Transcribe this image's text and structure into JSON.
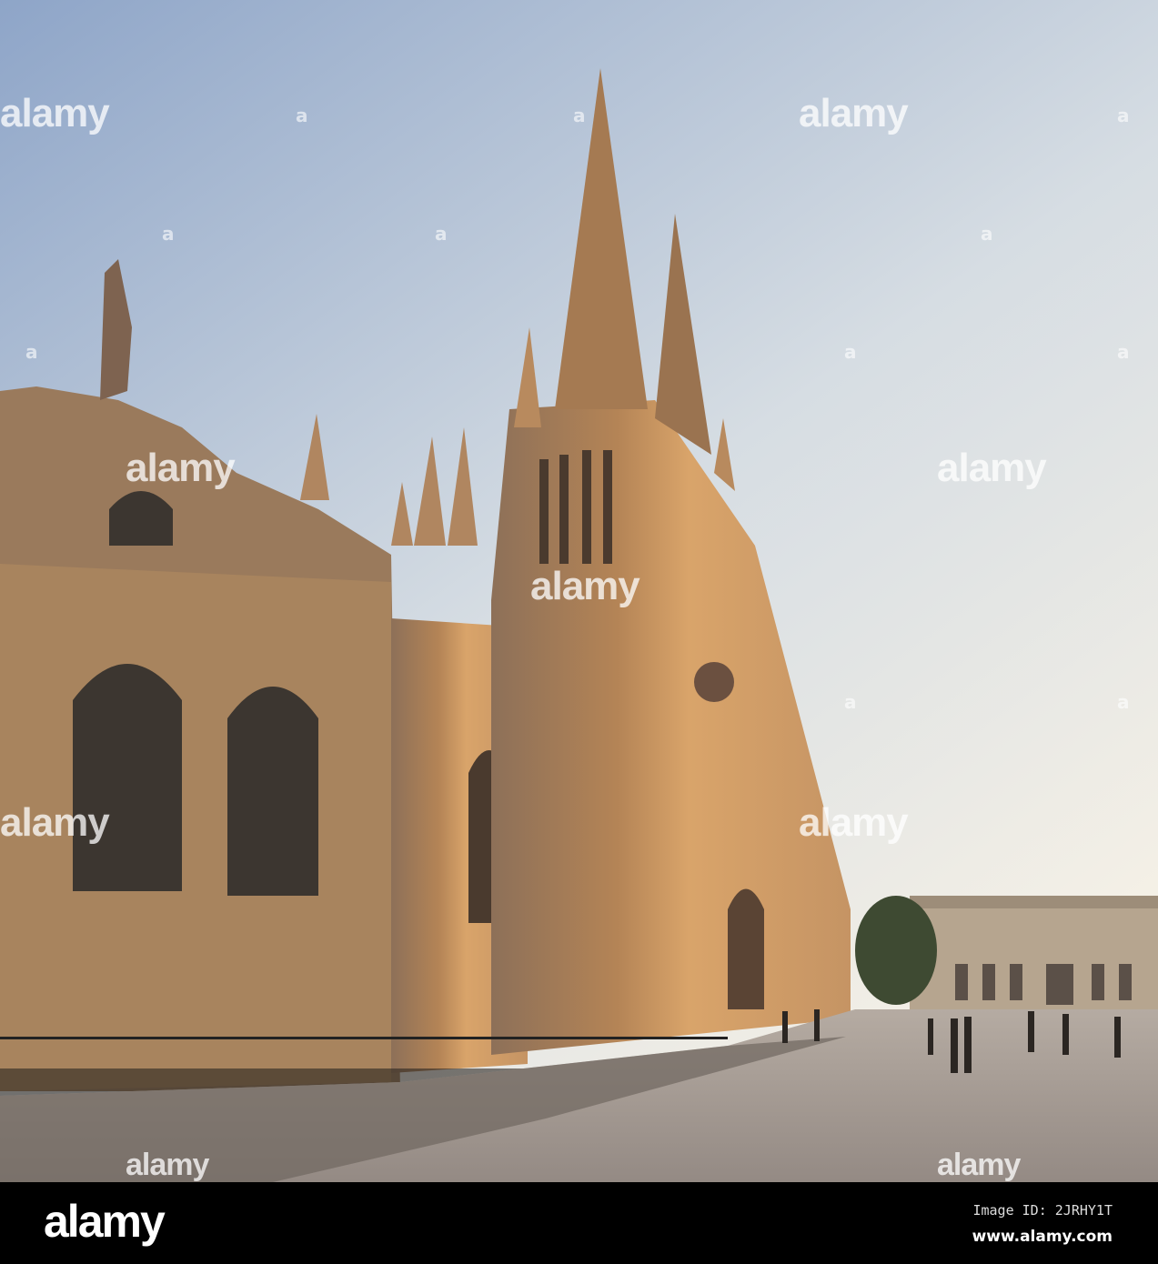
{
  "photo": {
    "subject": "cathedral",
    "colors": {
      "sky_top": "#8ea5c8",
      "sky_bottom": "#f3efe6",
      "stone_lit": "#d9a56a",
      "stone_shade": "#8a6a4e",
      "plaza": "#a59c94"
    }
  },
  "watermark": {
    "text": "alamy",
    "mark": "a"
  },
  "footer": {
    "logo": "alamy",
    "image_id": "Image ID: 2JRHY1T",
    "website": "www.alamy.com"
  }
}
